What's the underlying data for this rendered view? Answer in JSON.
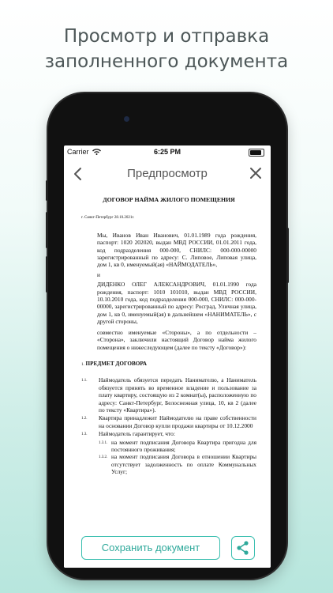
{
  "promo": {
    "line1": "Просмотр и отправка",
    "line2": "заполненного документа"
  },
  "status": {
    "carrier": "Carrier",
    "time": "6:25 PM"
  },
  "nav": {
    "title": "Предпросмотр"
  },
  "doc": {
    "title": "ДОГОВОР НАЙМА ЖИЛОГО ПОМЕЩЕНИЯ",
    "meta": "г. Санкт-Петербург 28.10.2021г.",
    "party1": "Мы, Иванов Иван Иванович, 01.01.1989 года рождения, паспорт: 1020 202020, выдан МВД РОССИИ, 01.01.2011 года, код подразделения 000-000, СНИЛС: 000-000-00000 зарегистрированный по адресу: С. Липовое, Липовая улица, дом 1, кв 0, именуемый(ая) «НАЙМОДАТЕЛЬ»,",
    "and": "и",
    "party2": "ДИДЕНКО ОЛЕГ АЛЕКСАНДРОВИЧ, 01.01.1990 года рождения, паспорт: 1010 101010, выдан МВД РОССИИ, 10.10.2010 года, код подразделения 000-000, СНИЛС: 000-000-00000, зарегистрированный по адресу: Роcград, Уличная улица, дом 1, кв 0, именуемый(ая) в дальнейшем «НАНИМАТЕЛЬ», с другой стороны,",
    "joint": "совместно именуемые «Стороны», а по отдельности – «Сторона», заключили настоящий Договор найма жилого помещения о нижеследующем (далее по тексту «Договор»):",
    "section_num": "1.",
    "section_title": "ПРЕДМЕТ ДОГОВОРА",
    "items": [
      {
        "num": "1.1.",
        "text": "Наймодатель обязуется передать Нанимателю, а Наниматель обязуется принять во временное владение и пользование за плату квартиру, состоящую из 2 комнат(ы), расположенную по адресу: Санкт-Петербург, Белоснежная улица, 10, кв 2 (далее по тексту «Квартира»)."
      },
      {
        "num": "1.2.",
        "text": "Квартира принадлежит Наймодателю на праве собственности на основании Договор купли продажи квартиры от 10.12.2000"
      },
      {
        "num": "1.3.",
        "text": "Наймодатель гарантирует, что:"
      }
    ],
    "subitems": [
      {
        "num": "1.3.1.",
        "text": "на момент подписания Договора Квартира пригодна для постоянного проживания;"
      },
      {
        "num": "1.3.2.",
        "text": "на момент подписания Договора в отношении Квартиры отсутствует задолженность по оплате Коммунальных Услуг;"
      }
    ]
  },
  "buttons": {
    "save": "Сохранить документ"
  },
  "icons": {
    "back": "chevron-left-icon",
    "close": "close-icon",
    "share": "share-icon",
    "wifi": "wifi-icon",
    "battery": "battery-icon"
  },
  "colors": {
    "accent": "#3bbfb0",
    "promo_text": "#4d5758"
  }
}
